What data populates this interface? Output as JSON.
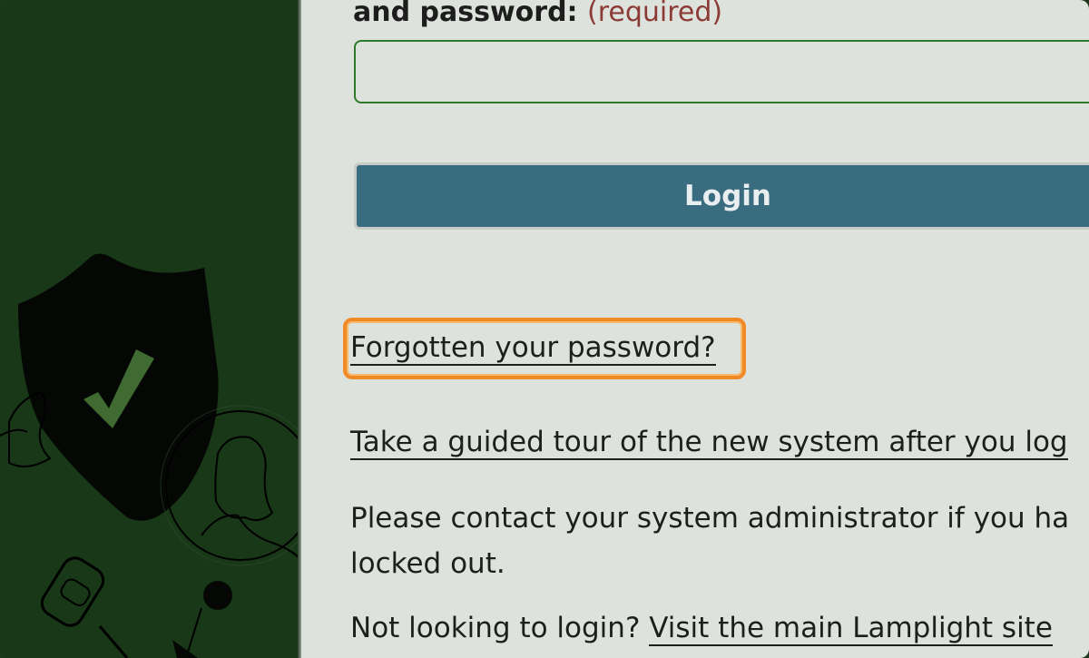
{
  "form": {
    "password_label": "and password:",
    "password_required": "(required)",
    "password_value": "",
    "login_label": "Login"
  },
  "links": {
    "forgot": "Forgotten your password?",
    "tour": "Take a guided tour of the new system after you log",
    "not_looking_prefix": "Not looking to login?",
    "main_site": "Visit the main Lamplight site"
  },
  "messages": {
    "contact_line1": "Please contact your system administrator if you ha",
    "contact_line2": "locked out."
  },
  "colors": {
    "panel_green": "#183817",
    "login_button": "#3a6c80",
    "highlight": "#f08a24",
    "required": "#8c3a36"
  }
}
